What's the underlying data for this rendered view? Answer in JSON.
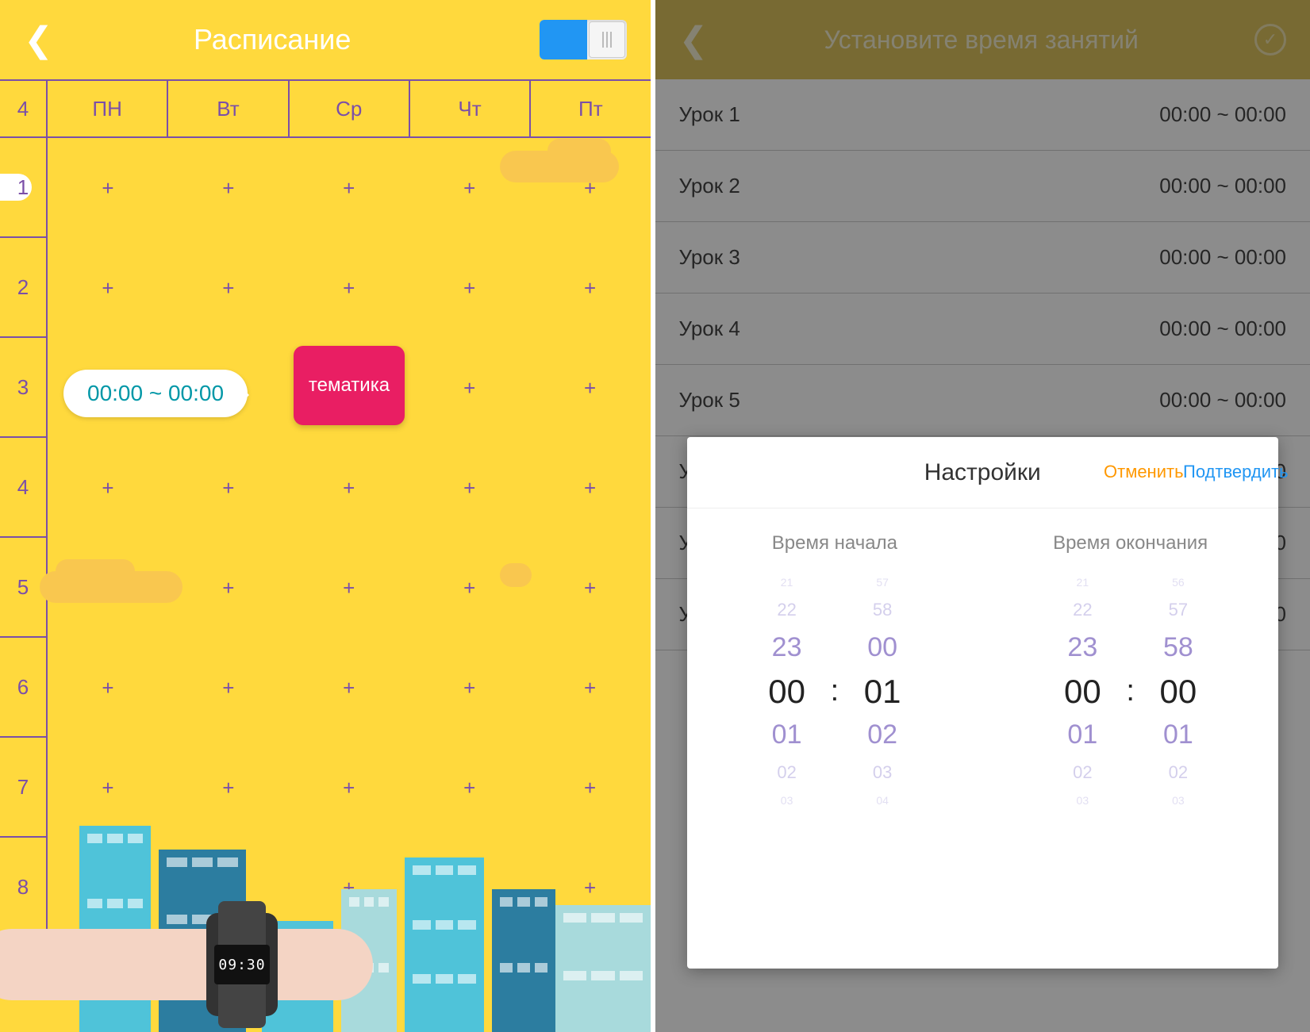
{
  "left": {
    "title": "Расписание",
    "corner": "4",
    "days": [
      "ПН",
      "Вт",
      "Ср",
      "Чт",
      "Пт"
    ],
    "rows": [
      "1",
      "2",
      "3",
      "4",
      "5",
      "6",
      "7",
      "8"
    ],
    "plus": "+",
    "time_bubble": "00:00 ~ 00:00",
    "subject": "тематика",
    "watch_time": "09:30"
  },
  "right": {
    "title": "Установите время занятий",
    "lessons": [
      {
        "name": "Урок 1",
        "time": "00:00 ~ 00:00"
      },
      {
        "name": "Урок 2",
        "time": "00:00 ~ 00:00"
      },
      {
        "name": "Урок 3",
        "time": "00:00 ~ 00:00"
      },
      {
        "name": "Урок 4",
        "time": "00:00 ~ 00:00"
      },
      {
        "name": "Урок 5",
        "time": "00:00 ~ 00:00"
      }
    ],
    "hidden_rows": [
      "У",
      "У",
      "У"
    ],
    "hidden_val": "0"
  },
  "modal": {
    "title": "Настройки",
    "cancel": "Отменить",
    "confirm": "Подтвердить",
    "start_label": "Время начала",
    "end_label": "Время окончания",
    "start_h": [
      "21",
      "22",
      "23",
      "00",
      "01",
      "02",
      "03"
    ],
    "start_m": [
      "57",
      "58",
      "00",
      "01",
      "02",
      "03",
      "04"
    ],
    "end_h": [
      "21",
      "22",
      "23",
      "00",
      "01",
      "02",
      "03"
    ],
    "end_m": [
      "56",
      "57",
      "58",
      "00",
      "01",
      "02",
      "03"
    ],
    "colon": ":"
  }
}
